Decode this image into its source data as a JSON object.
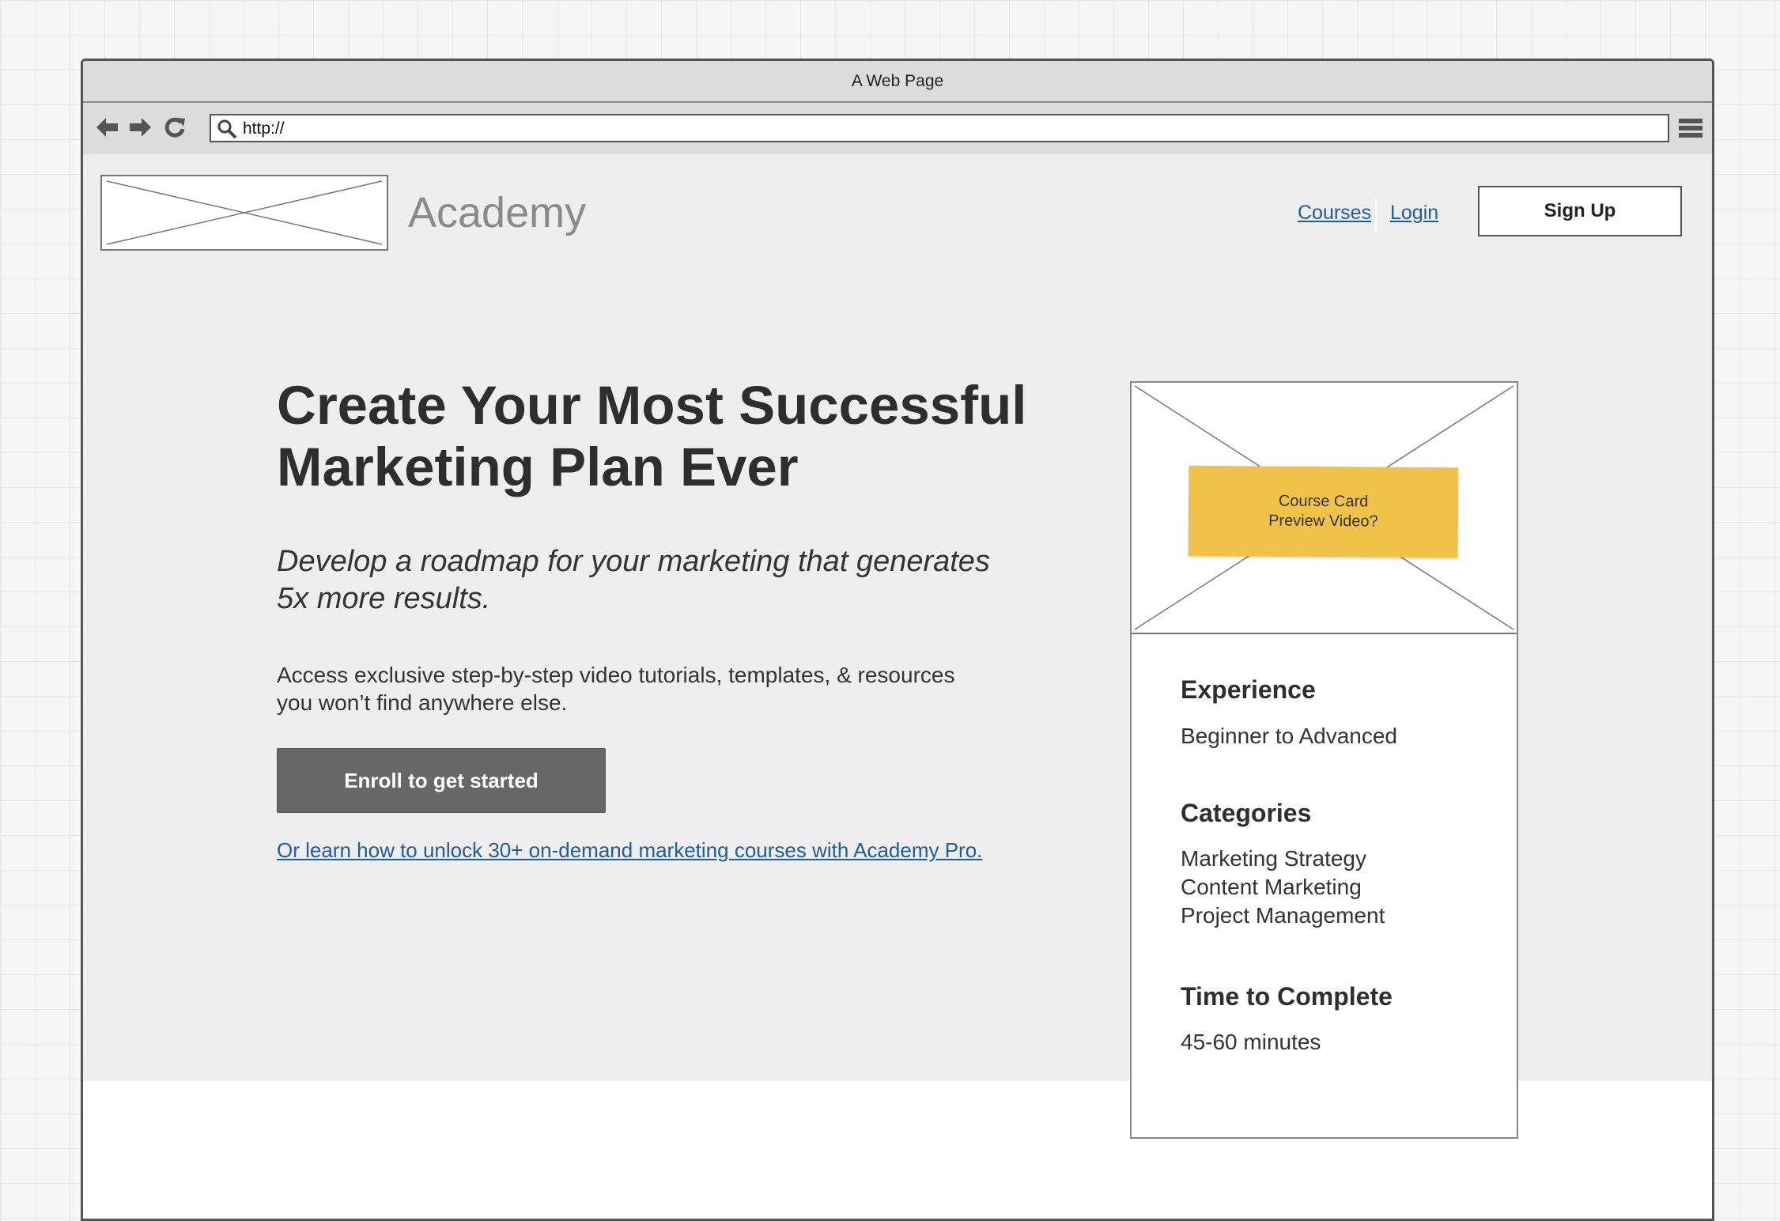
{
  "window": {
    "title": "A Web Page"
  },
  "browser": {
    "url": "http://"
  },
  "header": {
    "brand": "Academy",
    "links": [
      "Courses",
      "Login"
    ],
    "signup_label": "Sign Up"
  },
  "hero": {
    "headline_lines": [
      "Create Your Most Successful",
      "Marketing Plan Ever"
    ],
    "subhead_lines": [
      "Develop a roadmap for your marketing that generates",
      "5x more results."
    ],
    "body_lines": [
      "Access exclusive step-by-step video tutorials, templates, & resources",
      "you won’t find anywhere else."
    ],
    "cta_label": "Enroll to get started",
    "pro_link": "Or learn how to unlock 30+ on-demand marketing courses with Academy Pro."
  },
  "card": {
    "note_lines": [
      "Course Card",
      "Preview Video?"
    ],
    "note_color": "#f0c248",
    "sections": [
      {
        "heading": "Experience",
        "values": [
          "Beginner to Advanced"
        ]
      },
      {
        "heading": "Categories",
        "values": [
          "Marketing Strategy",
          "Content Marketing",
          "Project Management"
        ]
      },
      {
        "heading": "Time to Complete",
        "values": [
          "45-60 minutes"
        ]
      }
    ]
  },
  "icons": [
    "back-arrow-icon",
    "forward-arrow-icon",
    "reload-icon",
    "search-icon",
    "hamburger-menu-icon",
    "image-placeholder-icon"
  ]
}
